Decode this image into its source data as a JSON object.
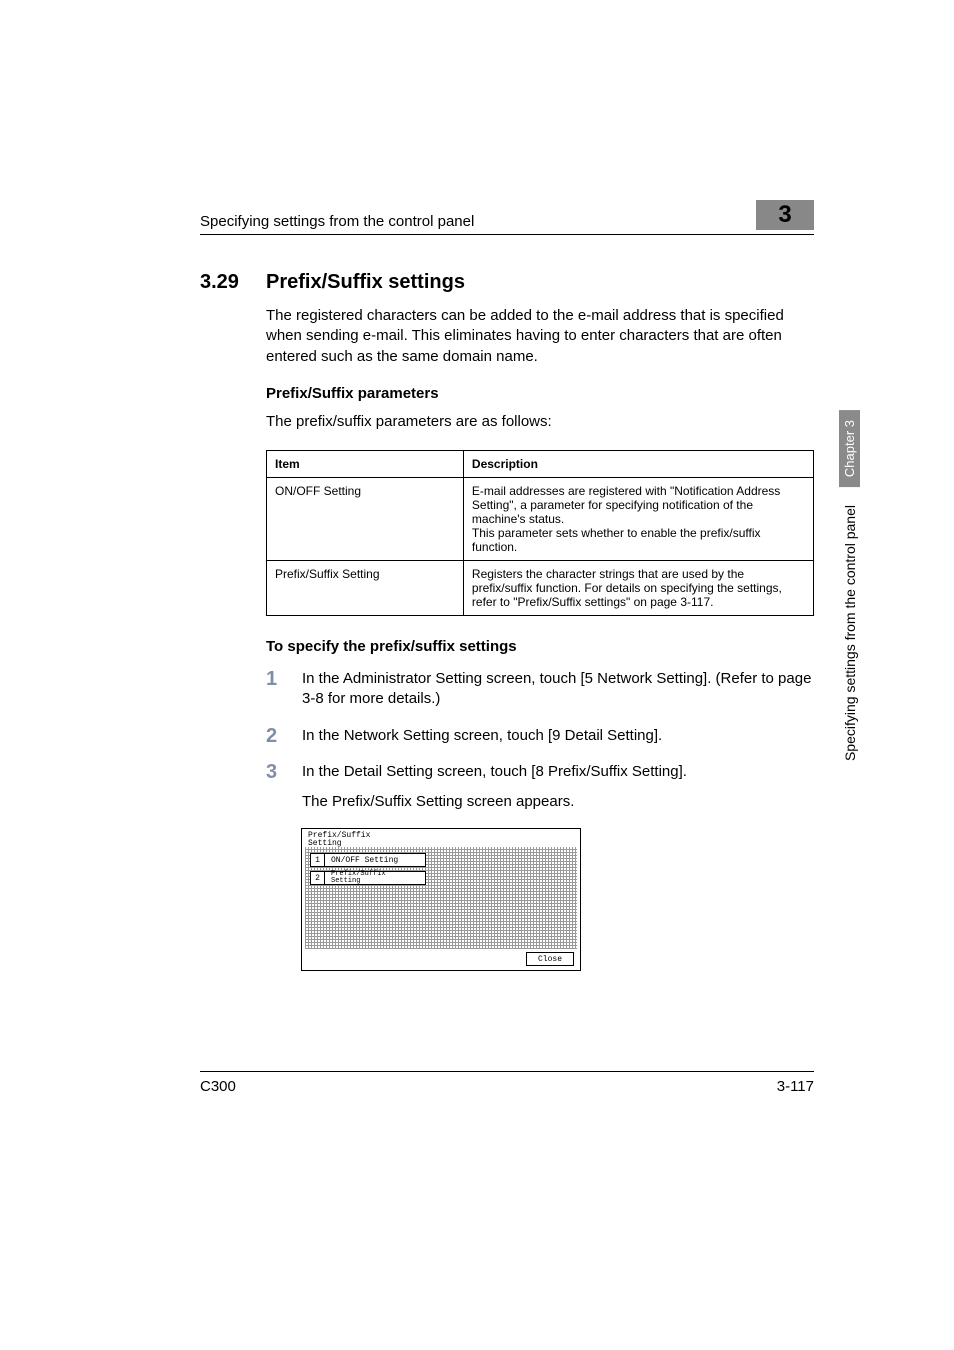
{
  "header": {
    "running": "Specifying settings from the control panel",
    "chapter_digit": "3"
  },
  "section": {
    "number": "3.29",
    "title": "Prefix/Suffix settings",
    "intro": "The registered characters can be added to the e-mail address that is specified when sending e-mail. This eliminates having to enter characters that are often entered such as the same domain name."
  },
  "params": {
    "heading": "Prefix/Suffix parameters",
    "lead": "The prefix/suffix parameters are as follows:",
    "cols": {
      "item": "Item",
      "desc": "Description"
    },
    "rows": [
      {
        "item": "ON/OFF Setting",
        "desc": "E-mail addresses are registered with \"Notification Address Setting\", a parameter for specifying notification of the machine's status.\nThis parameter sets whether to enable the prefix/suffix function."
      },
      {
        "item": "Prefix/Suffix Setting",
        "desc": "Registers the character strings that are used by the prefix/suffix function. For details on specifying the settings, refer to \"Prefix/Suffix settings\" on page 3-117."
      }
    ]
  },
  "procedure": {
    "heading": "To specify the prefix/suffix settings",
    "steps": [
      {
        "n": "1",
        "text": "In the Administrator Setting screen, touch [5 Network Setting]. (Refer to page 3-8 for more details.)"
      },
      {
        "n": "2",
        "text": "In the Network Setting screen, touch [9 Detail Setting]."
      },
      {
        "n": "3",
        "text": "In the Detail Setting screen, touch [8 Prefix/Suffix Setting].",
        "sub": "The Prefix/Suffix Setting screen appears."
      }
    ]
  },
  "screenshot": {
    "title": "Prefix/Suffix\nSetting",
    "btn1_num": "1",
    "btn1_label": "ON/OFF Setting",
    "btn2_num": "2",
    "btn2_label": "Prefix/Suffix\nSetting",
    "close": "Close"
  },
  "side": {
    "chapter_tab": "Chapter 3",
    "running": "Specifying settings from the control panel"
  },
  "footer": {
    "left": "C300",
    "right": "3-117"
  }
}
